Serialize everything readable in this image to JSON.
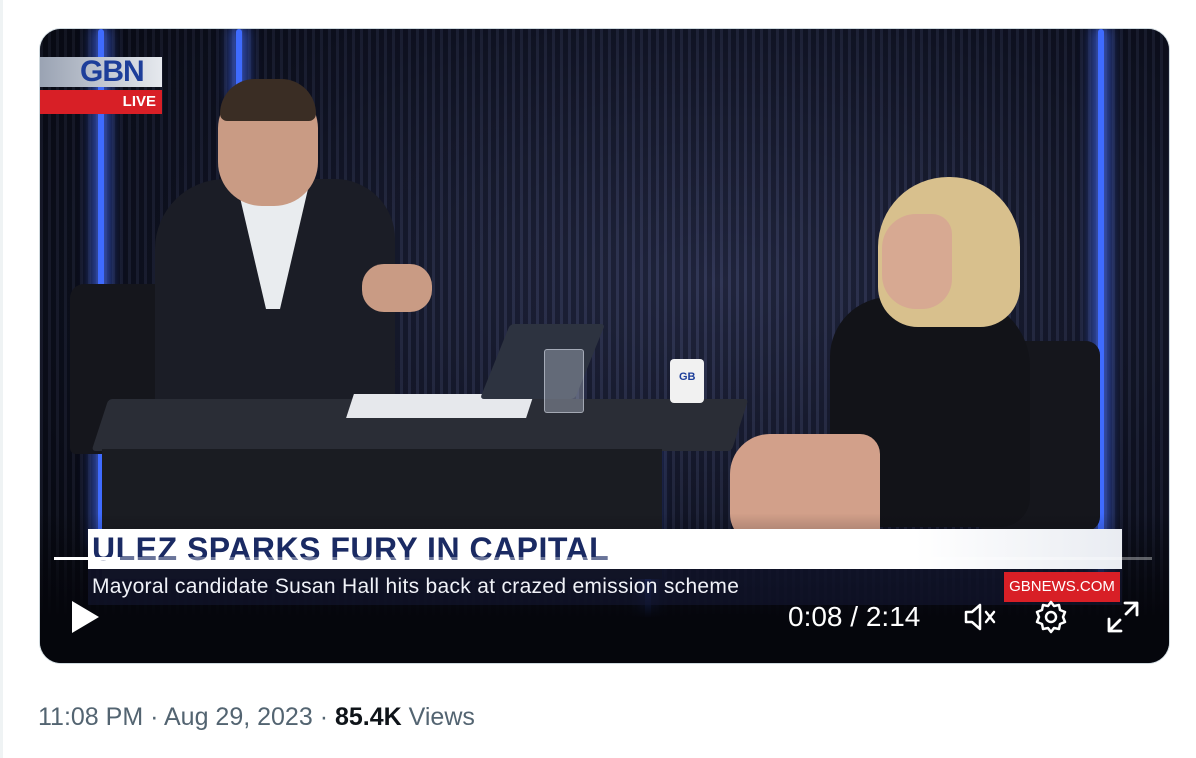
{
  "video": {
    "channel_logo": "GBN",
    "live_label": "LIVE",
    "headline": "ULEZ SPARKS FURY IN CAPITAL",
    "subheadline": "Mayoral candidate Susan Hall hits back at crazed emission scheme",
    "site_badge": "GBNEWS.COM",
    "mug_text": "GB"
  },
  "player": {
    "current_time": "0:08",
    "separator": " / ",
    "duration": "2:14",
    "progress_fraction": 0.06,
    "icons": [
      "play-icon",
      "muted-speaker-icon",
      "settings-gear-icon",
      "fullscreen-icon"
    ]
  },
  "tweet_meta": {
    "time": "11:08 PM",
    "sep1": " · ",
    "date": "Aug 29, 2023",
    "sep2": " · ",
    "views_count": "85.4K",
    "views_label": " Views"
  },
  "colors": {
    "accent_red": "#d81f26",
    "headline_blue": "#1a2a63",
    "neon_blue": "#3f6bff",
    "meta_gray": "#536471"
  }
}
